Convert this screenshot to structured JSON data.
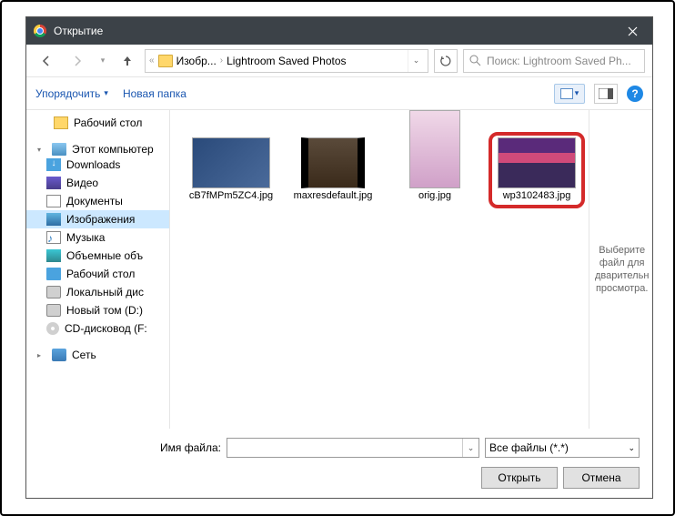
{
  "title": "Открытие",
  "breadcrumb": {
    "parent": "Изобр...",
    "current": "Lightroom Saved Photos"
  },
  "search_placeholder": "Поиск: Lightroom Saved Ph...",
  "toolbar": {
    "organize": "Упорядочить",
    "new_folder": "Новая папка"
  },
  "sidebar": {
    "desktop": "Рабочий стол",
    "this_pc": "Этот компьютер",
    "items": [
      "Downloads",
      "Видео",
      "Документы",
      "Изображения",
      "Музыка",
      "Объемные объ",
      "Рабочий стол",
      "Локальный дис",
      "Новый том (D:)",
      "CD-дисковод (F:"
    ],
    "network": "Сеть"
  },
  "files": [
    {
      "name": "cB7fMPm5ZC4.jpg"
    },
    {
      "name": "maxresdefault.jpg"
    },
    {
      "name": "orig.jpg"
    },
    {
      "name": "wp3102483.jpg"
    }
  ],
  "preview_hint": "Выберите файл для дварительн просмотра.",
  "filename_label": "Имя файла:",
  "filename_value": "",
  "filter": "Все файлы (*.*)",
  "buttons": {
    "open": "Открыть",
    "cancel": "Отмена"
  }
}
